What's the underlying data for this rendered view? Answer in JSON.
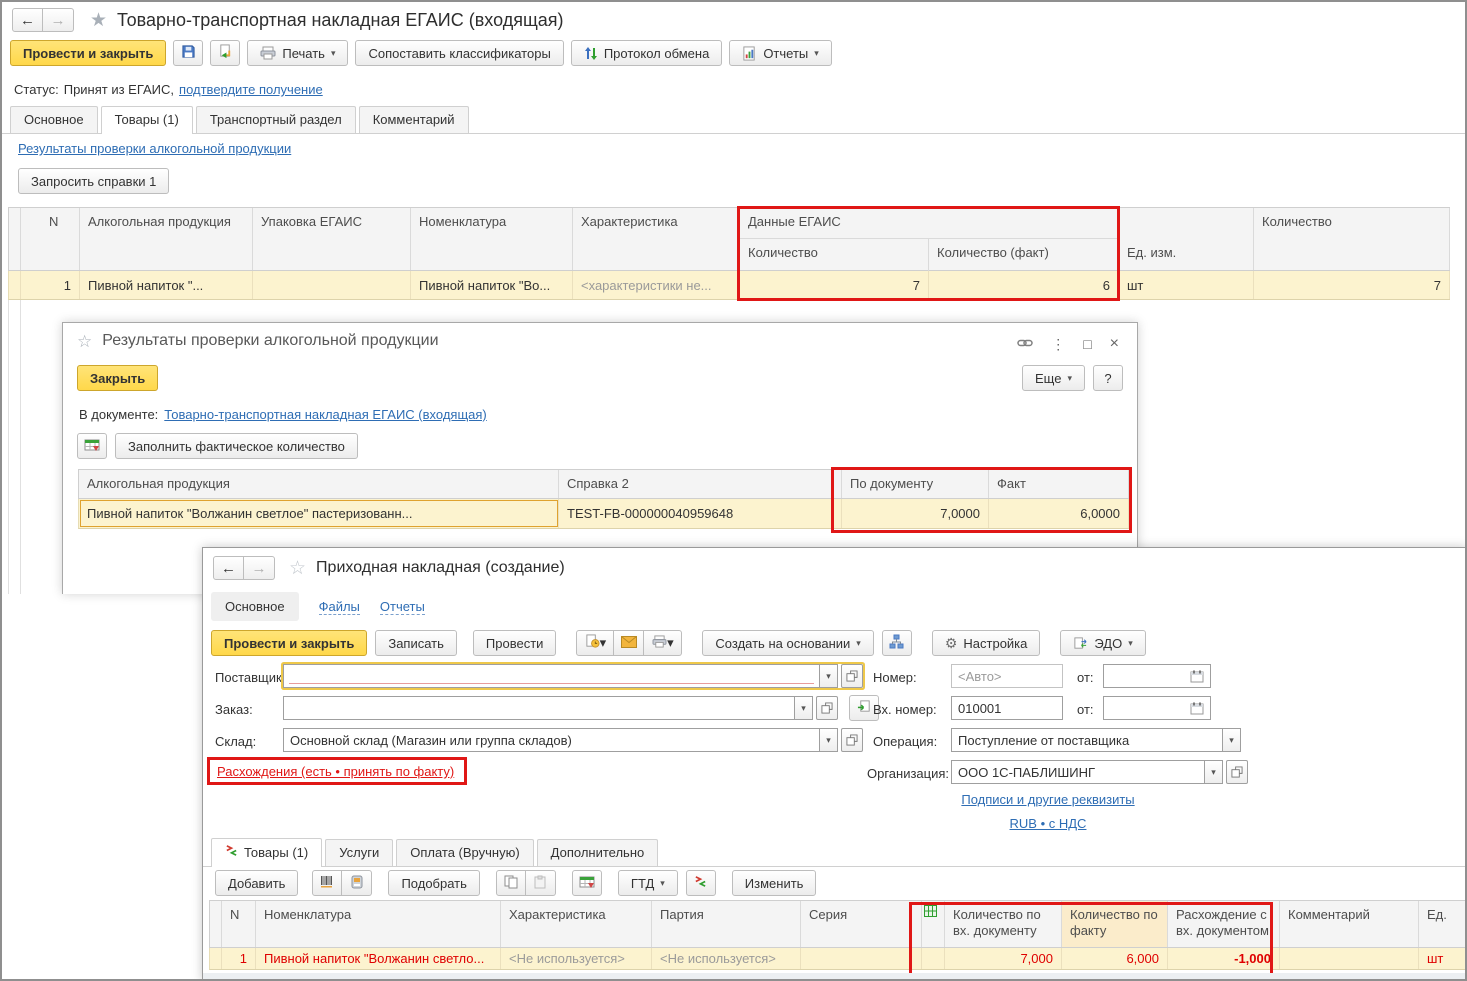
{
  "colors": {
    "accent_yellow": "#FFD84A",
    "row_highlight": "#FCF3CF",
    "alert_red": "#E01716",
    "link_blue": "#2E6DB4",
    "negative_red": "#DF0000"
  },
  "icons": {
    "back": "←",
    "forward": "→",
    "star_filled": "★",
    "star_outline": "☆",
    "dropdown": "▾",
    "kebab": "⋮",
    "maximize": "□",
    "close": "×",
    "gear": "⚙"
  },
  "w1": {
    "title": "Товарно-транспортная накладная ЕГАИС (входящая)",
    "toolbar": {
      "post_close": "Провести и закрыть",
      "print": "Печать",
      "compare": "Сопоставить классификаторы",
      "protocol": "Протокол обмена",
      "reports": "Отчеты"
    },
    "status": {
      "label": "Статус:",
      "text": "Принят из ЕГАИС,",
      "link": "подтвердите получение"
    },
    "tabs": [
      {
        "label": "Основное"
      },
      {
        "label": "Товары (1)"
      },
      {
        "label": "Транспортный раздел"
      },
      {
        "label": "Комментарий"
      }
    ],
    "check_results_link": "Результаты проверки алкогольной продукции",
    "request_button": "Запросить справки 1",
    "table": {
      "headers": {
        "n": "N",
        "alco": "Алкогольная продукция",
        "pack": "Упаковка ЕГАИС",
        "nomen": "Номенклатура",
        "charact": "Характеристика",
        "egais_group": "Данные ЕГАИС",
        "qty": "Количество",
        "qty_fact": "Количество (факт)",
        "unit": "Ед. изм.",
        "qty_total": "Количество"
      },
      "row": {
        "n": "1",
        "alco": "Пивной напиток \"...",
        "pack": "",
        "nomen": "Пивной напиток \"Во...",
        "charact": "<характеристики не...",
        "qty": "7",
        "qty_fact": "6",
        "unit": "шт",
        "qty_total": "7"
      }
    }
  },
  "dlg": {
    "title": "Результаты проверки алкогольной продукции",
    "close_button": "Закрыть",
    "more_button": "Еще",
    "help_button": "?",
    "in_doc_label": "В документе:",
    "in_doc_link": "Товарно-транспортная накладная ЕГАИС (входящая)",
    "fill_fact_button": "Заполнить фактическое количество",
    "table": {
      "headers": {
        "alco": "Алкогольная продукция",
        "cert": "Справка 2",
        "by_doc": "По документу",
        "fact": "Факт"
      },
      "row": {
        "alco": "Пивной напиток \"Волжанин светлое\" пастеризованн...",
        "cert": "TEST-FB-000000040959648",
        "by_doc": "7,0000",
        "fact": "6,0000"
      }
    }
  },
  "w2": {
    "title": "Приходная накладная (создание)",
    "nav_tabs": [
      {
        "label": "Основное"
      },
      {
        "label": "Файлы"
      },
      {
        "label": "Отчеты"
      }
    ],
    "toolbar": {
      "post_close": "Провести и закрыть",
      "write": "Записать",
      "post": "Провести",
      "create_based": "Создать на основании",
      "settings": "Настройка",
      "edo": "ЭДО"
    },
    "form": {
      "supplier_label": "Поставщик:",
      "supplier_value": "",
      "order_label": "Заказ:",
      "order_value": "",
      "warehouse_label": "Склад:",
      "warehouse_value": "Основной склад (Магазин или группа складов)",
      "discrepancy_link": "Расхождения (есть • принять по факту)",
      "number_label": "Номер:",
      "number_placeholder": "<Авто>",
      "from_label_1": "от:",
      "in_number_label": "Вх. номер:",
      "in_number_value": "010001",
      "from_label_2": "от:",
      "operation_label": "Операция:",
      "operation_value": "Поступление от поставщика",
      "org_label": "Организация:",
      "org_value": "ООО 1С-ПАБЛИШИНГ",
      "signatures_link": "Подписи и другие реквизиты",
      "currency_link": "RUB • с НДС"
    },
    "section_tabs": [
      {
        "label": "Товары (1)"
      },
      {
        "label": "Услуги"
      },
      {
        "label": "Оплата (Вручную)"
      },
      {
        "label": "Дополнительно"
      }
    ],
    "table_toolbar": {
      "add": "Добавить",
      "pick": "Подобрать",
      "gtd": "ГТД",
      "edit": "Изменить"
    },
    "table": {
      "headers": {
        "n": "N",
        "nomen": "Номенклатура",
        "charact": "Характеристика",
        "batch": "Партия",
        "series": "Серия",
        "qty_doc": "Количество по вх. документу",
        "qty_fact": "Количество по факту",
        "diff": "Расхождение с вх. документом",
        "comment": "Комментарий",
        "unit": "Ед."
      },
      "row": {
        "n": "1",
        "nomen": "Пивной напиток \"Волжанин светло...",
        "charact": "<Не используется>",
        "batch": "<Не используется>",
        "series": "",
        "qty_doc": "7,000",
        "qty_fact": "6,000",
        "diff": "-1,000",
        "comment": "",
        "unit": "шт"
      }
    }
  }
}
